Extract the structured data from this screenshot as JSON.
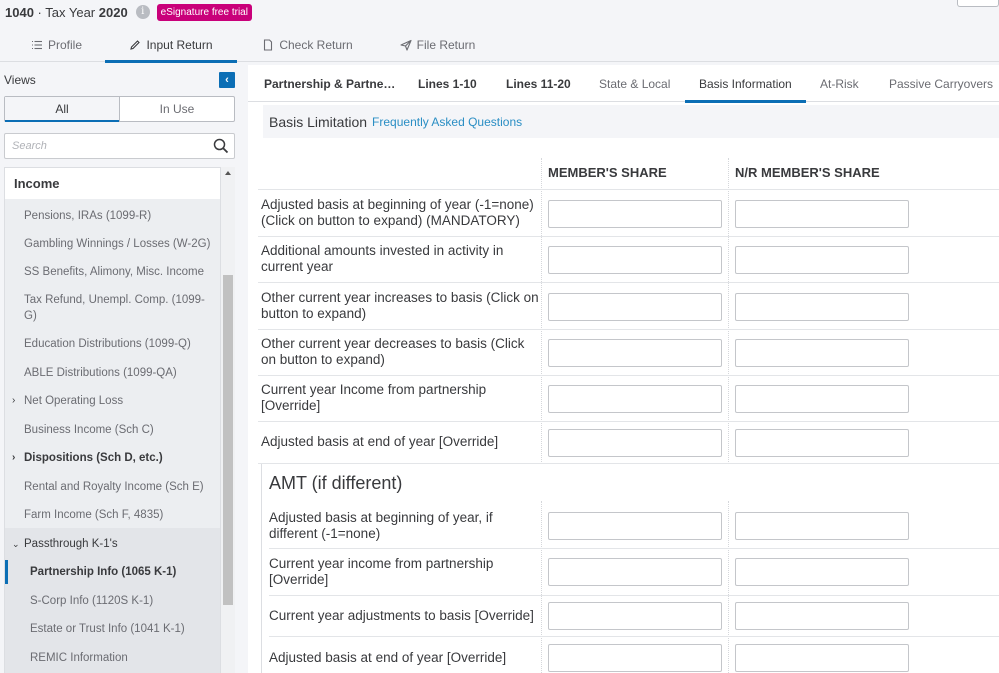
{
  "header": {
    "form": "1040",
    "separator": " · ",
    "tax_year_label": "Tax Year ",
    "tax_year": "2020",
    "info_icon": "i",
    "badge": "eSignature free trial",
    "badge_color": "#c9007a"
  },
  "main_tabs": [
    {
      "label": "Profile",
      "icon": "list-icon",
      "active": false
    },
    {
      "label": "Input Return",
      "icon": "pencil-icon",
      "active": true
    },
    {
      "label": "Check Return",
      "icon": "document-icon",
      "active": false
    },
    {
      "label": "File Return",
      "icon": "send-icon",
      "active": false
    }
  ],
  "sidebar": {
    "views_label": "Views",
    "collapse_icon": "‹",
    "segments": {
      "all": "All",
      "in_use": "In Use",
      "selected": "All"
    },
    "search_placeholder": "Search",
    "section_title": "Income",
    "items": [
      {
        "label": "Pensions, IRAs (1099-R)"
      },
      {
        "label": "Gambling Winnings / Losses (W-2G)"
      },
      {
        "label": "SS Benefits, Alimony, Misc. Income"
      },
      {
        "label": "Tax Refund, Unempl. Comp. (1099-G)"
      },
      {
        "label": "Education Distributions (1099-Q)"
      },
      {
        "label": "ABLE Distributions (1099-QA)"
      },
      {
        "label": "Net Operating Loss",
        "expandable": true
      },
      {
        "label": "Business Income (Sch C)"
      },
      {
        "label": "Dispositions (Sch D, etc.)",
        "expandable": true,
        "bold": true
      },
      {
        "label": "Rental and Royalty Income (Sch E)"
      },
      {
        "label": "Farm Income (Sch F, 4835)"
      },
      {
        "label": "Passthrough K-1's",
        "expanded": true
      },
      {
        "label": "Partnership Info (1065 K-1)",
        "selected": true
      },
      {
        "label": "S-Corp Info (1120S K-1)"
      },
      {
        "label": "Estate or Trust Info (1041 K-1)"
      },
      {
        "label": "REMIC Information"
      }
    ]
  },
  "sub_tabs": [
    {
      "label": "Partnership & Partne…",
      "bold": true
    },
    {
      "label": "Lines 1-10",
      "bold": true
    },
    {
      "label": "Lines 11-20",
      "bold": true
    },
    {
      "label": "State & Local"
    },
    {
      "label": "Basis Information",
      "active": true
    },
    {
      "label": "At-Risk"
    },
    {
      "label": "Passive Carryovers"
    }
  ],
  "section": {
    "title": "Basis Limitation",
    "faq_link": "Frequently Asked Questions"
  },
  "columns": [
    "MEMBER'S SHARE",
    "N/R MEMBER'S SHARE"
  ],
  "rows": [
    {
      "label": "Adjusted basis at beginning of year (-1=none) (Click on button to expand) (MANDATORY)",
      "member": "",
      "nr_member": ""
    },
    {
      "label": "Additional amounts invested in activity in current year",
      "member": "",
      "nr_member": ""
    },
    {
      "label": "Other current year increases to basis (Click on button to expand)",
      "member": "",
      "nr_member": ""
    },
    {
      "label": "Other current year decreases to basis (Click on button to expand)",
      "member": "",
      "nr_member": ""
    },
    {
      "label": "Current year Income from partnership [Override]",
      "member": "",
      "nr_member": ""
    },
    {
      "label": "Adjusted basis at end of year [Override]",
      "member": "",
      "nr_member": ""
    }
  ],
  "amt": {
    "title": "AMT (if different)",
    "rows": [
      {
        "label": "Adjusted basis at beginning of year, if different (-1=none)",
        "member": "",
        "nr_member": ""
      },
      {
        "label": "Current year income from partnership [Override]",
        "member": "",
        "nr_member": ""
      },
      {
        "label": "Current year adjustments to basis [Override]",
        "member": "",
        "nr_member": ""
      },
      {
        "label": "Adjusted basis at end of year [Override]",
        "member": "",
        "nr_member": ""
      }
    ]
  },
  "colors": {
    "accent": "#0b6eb5",
    "link": "#2a8ec4"
  }
}
